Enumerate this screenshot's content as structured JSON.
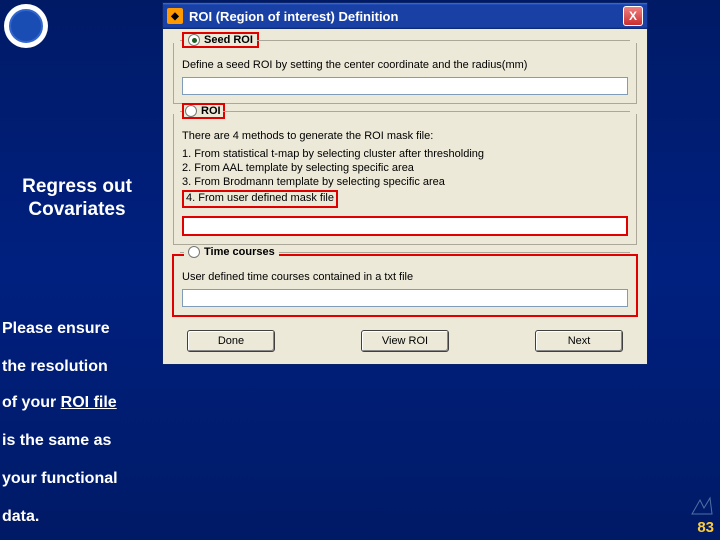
{
  "slide": {
    "logo_alt": "institute-logo",
    "page_number": "83",
    "heading_line1": "Regress out",
    "heading_line2": "Covariates",
    "note1": "Please ensure",
    "note2": "the resolution",
    "note3a": "of your ",
    "note3b": "ROI file",
    "note4": "is the same as",
    "note5": "your functional",
    "note6": "data."
  },
  "dialog": {
    "title": "ROI (Region of interest) Definition",
    "close_label": "X",
    "seed": {
      "radio_label": "Seed ROI",
      "desc": "Define a seed ROI by setting the center coordinate and the radius(mm)",
      "value": ""
    },
    "roi": {
      "radio_label": "ROI",
      "desc": "There are 4 methods to generate the ROI mask file:",
      "m1": "1. From statistical t-map by selecting cluster after thresholding",
      "m2": "2. From AAL template by selecting specific area",
      "m3": "3. From Brodmann template by selecting specific area",
      "m4": "4. From user defined mask file",
      "value": ""
    },
    "tc": {
      "radio_label": "Time courses",
      "desc": "User defined time courses contained in a txt file",
      "value": ""
    },
    "buttons": {
      "done": "Done",
      "view": "View ROI",
      "next": "Next"
    }
  }
}
